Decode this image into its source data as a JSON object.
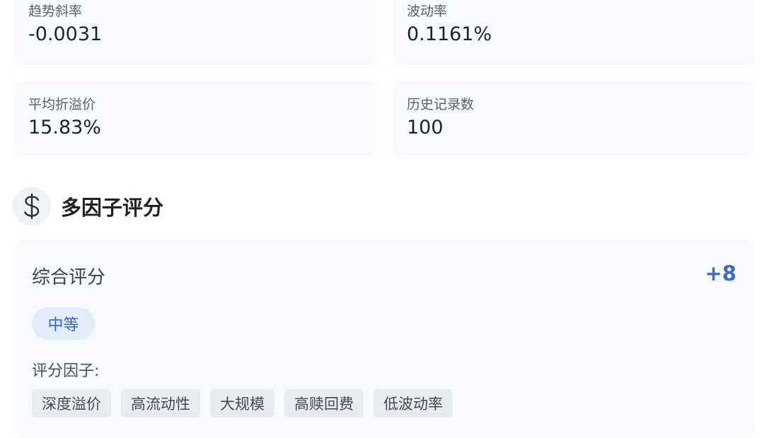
{
  "stats": [
    {
      "label": "趋势斜率",
      "value": "-0.0031"
    },
    {
      "label": "波动率",
      "value": "0.1161%"
    },
    {
      "label": "平均折溢价",
      "value": "15.83%"
    },
    {
      "label": "历史记录数",
      "value": "100"
    }
  ],
  "section": {
    "icon": "dollar-icon",
    "title": "多因子评分"
  },
  "score": {
    "label": "综合评分",
    "value": "+8",
    "level": "中等",
    "factors_label": "评分因子:",
    "factors": [
      "深度溢价",
      "高流动性",
      "大规模",
      "高赎回费",
      "低波动率"
    ]
  },
  "colors": {
    "accent": "#3f6bc4",
    "badge_bg": "#e3ecfb",
    "card_bg": "#f7f9fc",
    "chip_bg": "#e8ebf0"
  }
}
